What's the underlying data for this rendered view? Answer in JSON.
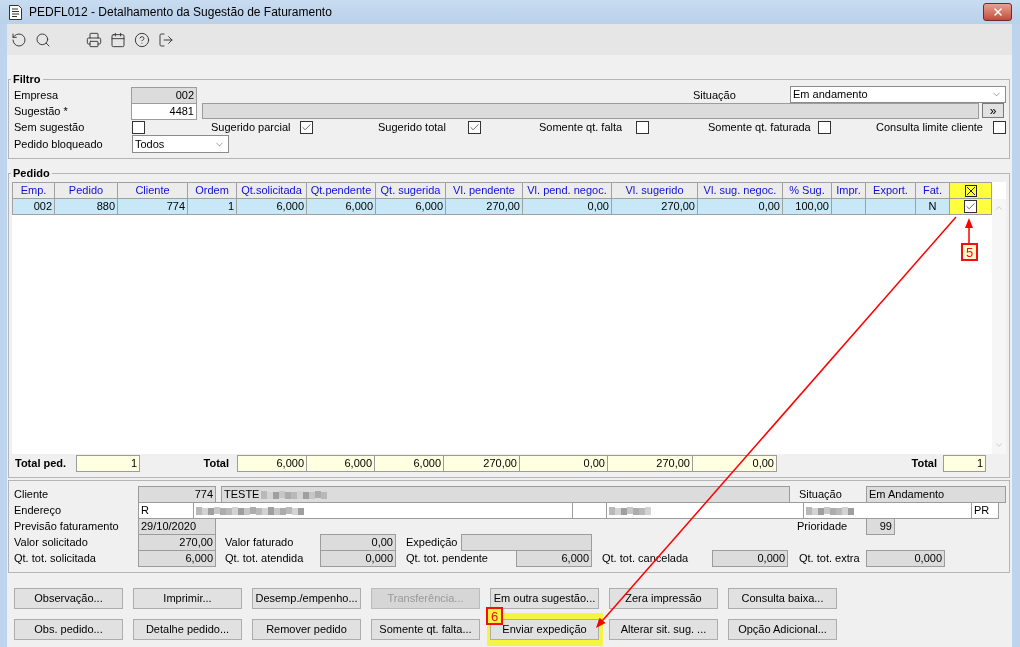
{
  "window": {
    "title": "PEDFL012 - Detalhamento da Sugestão de Faturamento"
  },
  "filter": {
    "title": "Filtro",
    "empresa": {
      "label": "Empresa",
      "value": "002"
    },
    "situacao": {
      "label": "Situação",
      "value": "Em andamento"
    },
    "sugestao": {
      "label": "Sugestão *",
      "value": "4481",
      "lookup_button": "»"
    },
    "checkboxes": [
      {
        "label": "Sem sugestão",
        "checked": false
      },
      {
        "label": "Sugerido parcial",
        "checked": true
      },
      {
        "label": "Sugerido total",
        "checked": true
      },
      {
        "label": "Somente qt. falta",
        "checked": false
      },
      {
        "label": "Somente qt. faturada",
        "checked": false
      },
      {
        "label": "Consulta limite cliente",
        "checked": false
      }
    ],
    "pedido_bloqueado": {
      "label": "Pedido bloqueado",
      "value": "Todos"
    }
  },
  "pedido": {
    "title": "Pedido",
    "columns": [
      "Emp.",
      "Pedido",
      "Cliente",
      "Ordem",
      "Qt.solicitada",
      "Qt.pendente",
      "Qt. sugerida",
      "Vl. pendente",
      "Vl. pend. negoc.",
      "Vl. sugerido",
      "Vl. sug. negoc.",
      "% Sug.",
      "Impr.",
      "Export.",
      "Fat."
    ],
    "rows": [
      {
        "cells": [
          "002",
          "880",
          "774",
          "1",
          "6,000",
          "6,000",
          "6,000",
          "270,00",
          "0,00",
          "270,00",
          "0,00",
          "100,00",
          null,
          null,
          "N"
        ],
        "selected": true,
        "checked": true
      }
    ],
    "totals": {
      "count_label": "Total ped.",
      "count": "1",
      "sum_label": "Total",
      "sums": [
        "6,000",
        "6,000",
        "6,000",
        "270,00",
        "0,00",
        "270,00",
        "0,00"
      ],
      "right_label": "Total",
      "right_value": "1"
    }
  },
  "detail": {
    "cliente": {
      "label": "Cliente",
      "code": "774",
      "name": "TESTE",
      "name_redacted": true
    },
    "situacao": {
      "label": "Situação",
      "value": "Em Andamento"
    },
    "endereco": {
      "label": "Endereço",
      "fields": [
        {
          "value": "R",
          "redacted": false
        },
        {
          "redacted": true
        },
        {
          "redacted": false
        },
        {
          "redacted": true
        },
        {
          "redacted": true
        },
        {
          "value": "PR",
          "redacted": false
        }
      ]
    },
    "previsao": {
      "label": "Previsão faturamento",
      "value": "29/10/2020"
    },
    "prioridade": {
      "label": "Prioridade",
      "value": "99"
    },
    "valor_solicitado": {
      "label": "Valor solicitado",
      "value": "270,00"
    },
    "valor_faturado": {
      "label": "Valor faturado",
      "value": "0,00"
    },
    "expedicao": {
      "label": "Expedição"
    },
    "qt_tot_solicitada": {
      "label": "Qt. tot. solicitada",
      "value": "6,000"
    },
    "qt_tot_atendida": {
      "label": "Qt. tot. atendida",
      "value": "0,000"
    },
    "qt_tot_pendente": {
      "label": "Qt. tot. pendente",
      "value": "6,000"
    },
    "qt_tot_cancelada": {
      "label": "Qt. tot. cancelada",
      "value": "0,000"
    },
    "qt_tot_extra": {
      "label": "Qt. tot. extra",
      "value": "0,000"
    }
  },
  "actions": [
    [
      {
        "label": "Observação...",
        "disabled": false,
        "highlighted": false
      },
      {
        "label": "Imprimir...",
        "disabled": false,
        "highlighted": false
      },
      {
        "label": "Desemp./empenho...",
        "disabled": false,
        "highlighted": false
      },
      {
        "label": "Transferência...",
        "disabled": true,
        "highlighted": false
      },
      {
        "label": "Em outra sugestão...",
        "disabled": false,
        "highlighted": false
      },
      {
        "label": "Zera impressão",
        "disabled": false,
        "highlighted": false
      },
      {
        "label": "Consulta baixa...",
        "disabled": false,
        "highlighted": false
      }
    ],
    [
      {
        "label": "Obs. pedido...",
        "disabled": false,
        "highlighted": false
      },
      {
        "label": "Detalhe pedido...",
        "disabled": false,
        "highlighted": false
      },
      {
        "label": "Remover pedido",
        "disabled": false,
        "highlighted": false
      },
      {
        "label": "Somente qt. falta...",
        "disabled": false,
        "highlighted": false
      },
      {
        "label": "Enviar expedição",
        "disabled": false,
        "highlighted": true
      },
      {
        "label": "Alterar sit. sug. ...",
        "disabled": false,
        "highlighted": false
      },
      {
        "label": "Opção Adicional...",
        "disabled": false,
        "highlighted": false
      }
    ]
  ],
  "annotations": [
    {
      "label": "5"
    },
    {
      "label": "6"
    }
  ]
}
